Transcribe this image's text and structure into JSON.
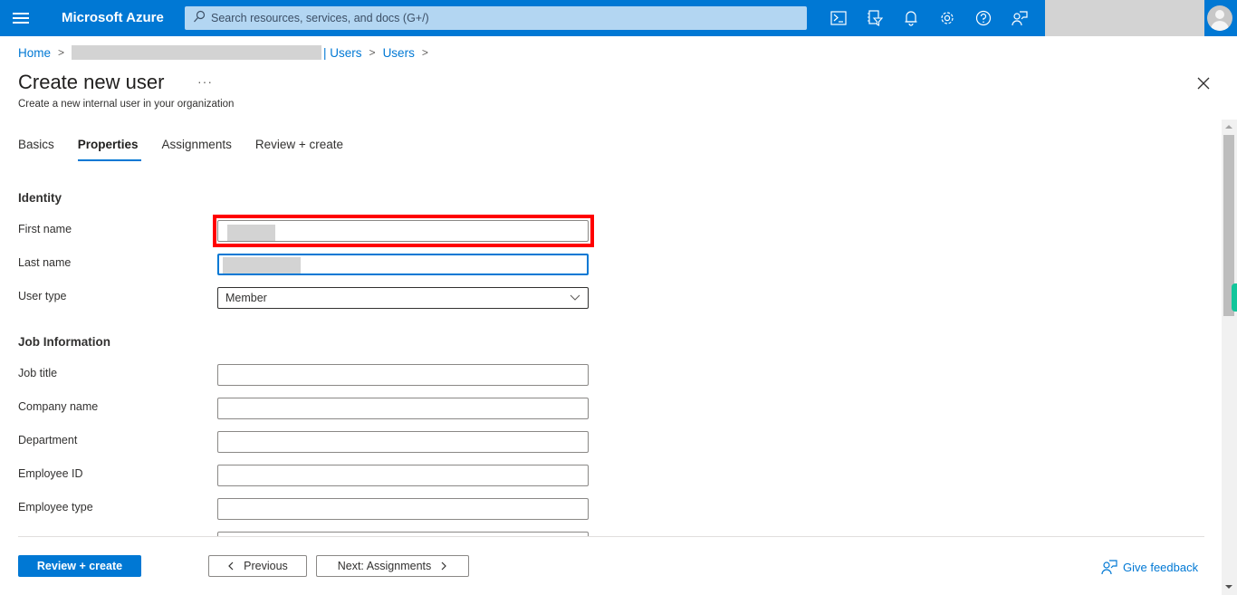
{
  "topbar": {
    "brand": "Microsoft Azure",
    "search_placeholder": "Search resources, services, and docs (G+/)",
    "icons": [
      "cloud-shell-icon",
      "directory-filter-icon",
      "notifications-icon",
      "settings-icon",
      "help-icon",
      "feedback-icon"
    ],
    "accent_color": "#0078d4"
  },
  "breadcrumb": {
    "home": "Home",
    "tenant_suffix": "| Users",
    "current": "Users"
  },
  "page": {
    "title": "Create new user",
    "more_label": "···",
    "subtitle": "Create a new internal user in your organization"
  },
  "tabs": [
    {
      "label": "Basics",
      "active": false
    },
    {
      "label": "Properties",
      "active": true
    },
    {
      "label": "Assignments",
      "active": false
    },
    {
      "label": "Review + create",
      "active": false
    }
  ],
  "identity": {
    "section_title": "Identity",
    "first_name_label": "First name",
    "last_name_label": "Last name",
    "user_type_label": "User type",
    "user_type_value": "Member"
  },
  "job": {
    "section_title": "Job Information",
    "fields": [
      {
        "label": "Job title",
        "value": ""
      },
      {
        "label": "Company name",
        "value": ""
      },
      {
        "label": "Department",
        "value": ""
      },
      {
        "label": "Employee ID",
        "value": ""
      },
      {
        "label": "Employee type",
        "value": ""
      }
    ]
  },
  "footer": {
    "review_create": "Review + create",
    "previous": "Previous",
    "next": "Next: Assignments",
    "feedback": "Give feedback"
  }
}
